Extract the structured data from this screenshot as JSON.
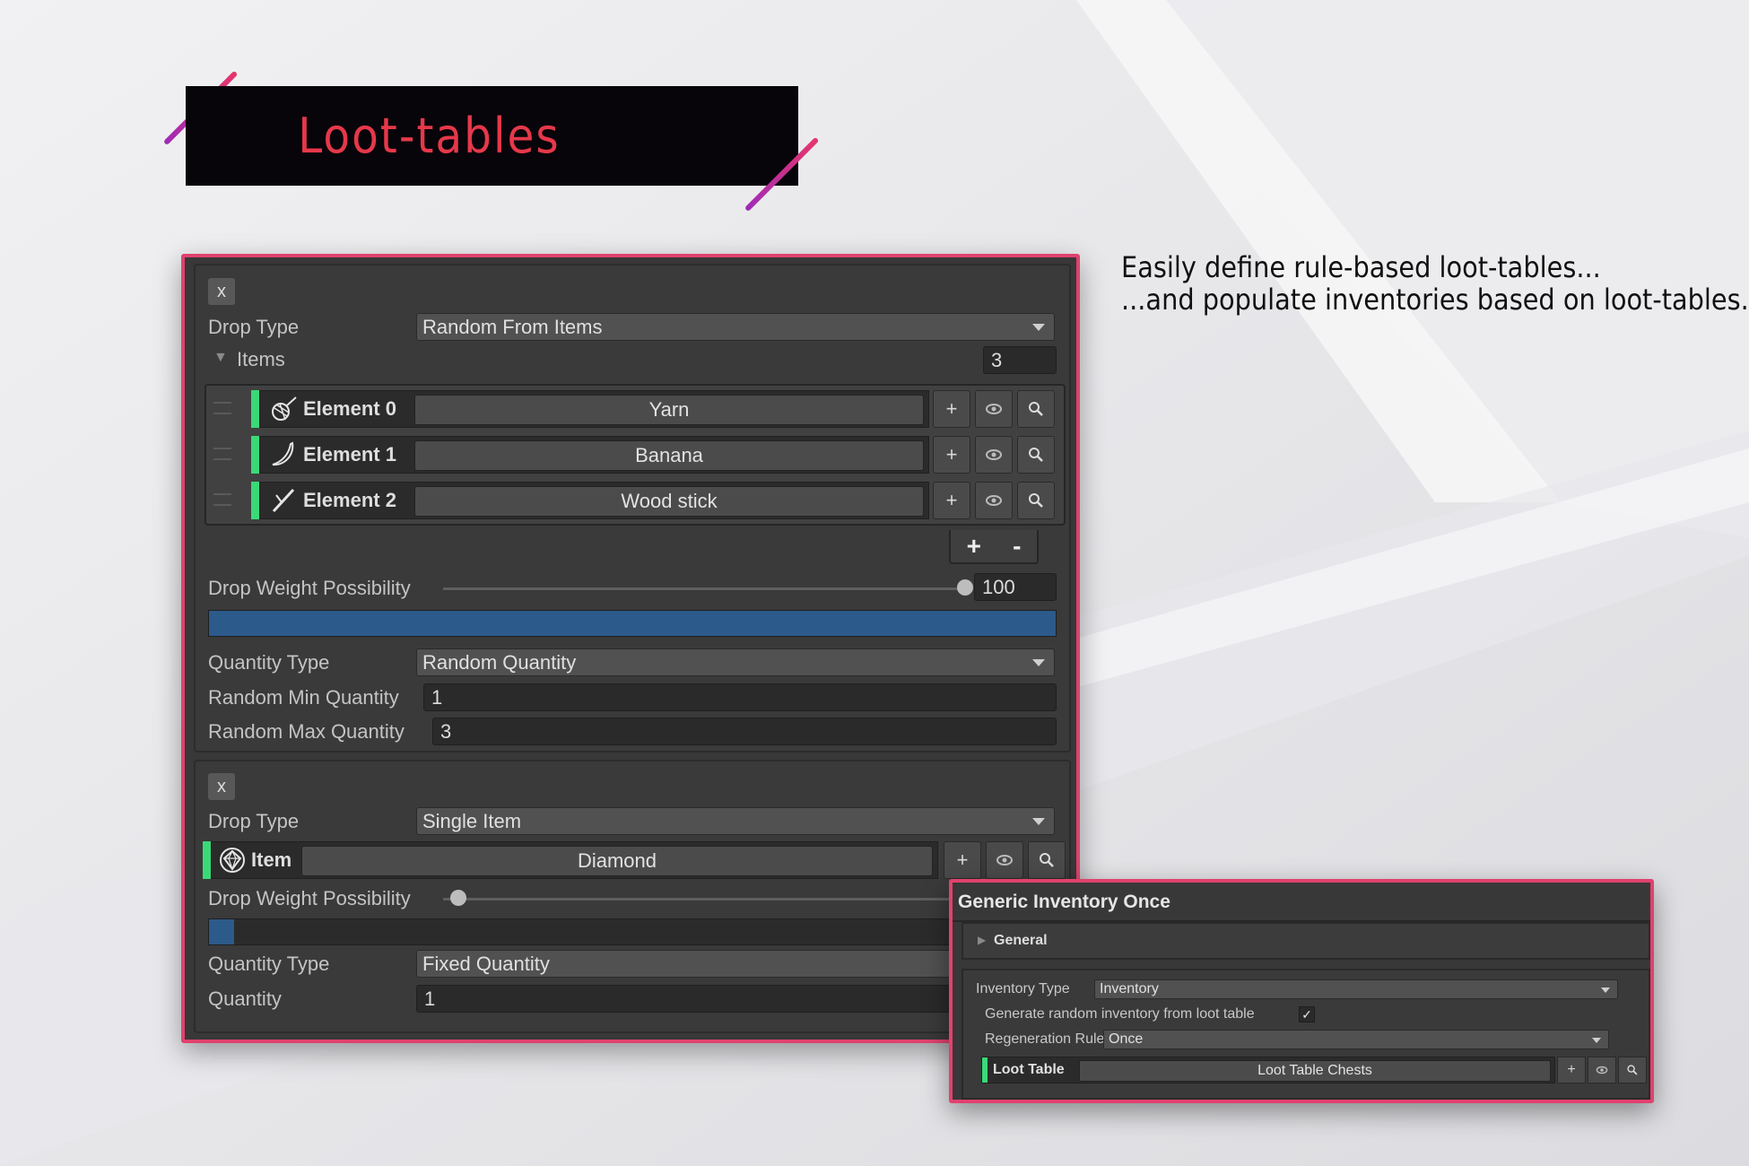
{
  "banner": {
    "title": "Loot-tables"
  },
  "description": {
    "line1": "Easily define rule-based loot-tables...",
    "line2": "...and populate inventories based on loot-tables."
  },
  "entry1": {
    "remove_label": "x",
    "drop_type_label": "Drop Type",
    "drop_type_value": "Random From Items",
    "items_label": "Items",
    "items_count": "3",
    "elements": [
      {
        "label": "Element 0",
        "value": "Yarn",
        "icon": "yarn-icon"
      },
      {
        "label": "Element 1",
        "value": "Banana",
        "icon": "banana-icon"
      },
      {
        "label": "Element 2",
        "value": "Wood stick",
        "icon": "wood-stick-icon"
      }
    ],
    "add_label": "+",
    "remove_item_label": "-",
    "drop_weight_label": "Drop Weight Possibility",
    "drop_weight_value": "100",
    "drop_weight_fraction": 1.0,
    "quantity_type_label": "Quantity Type",
    "quantity_type_value": "Random Quantity",
    "min_label": "Random Min Quantity",
    "min_value": "1",
    "max_label": "Random Max Quantity",
    "max_value": "3"
  },
  "entry2": {
    "remove_label": "x",
    "drop_type_label": "Drop Type",
    "drop_type_value": "Single Item",
    "item_label": "Item",
    "item_value": "Diamond",
    "drop_weight_label": "Drop Weight Possibility",
    "drop_weight_fraction": 0.03,
    "quantity_type_label": "Quantity Type",
    "quantity_type_value": "Fixed Quantity",
    "quantity_label": "Quantity",
    "quantity_value": "1"
  },
  "inventory": {
    "title": "Generic Inventory Once",
    "general_label": "General",
    "inventory_type_label": "Inventory Type",
    "inventory_type_value": "Inventory",
    "generate_label": "Generate random inventory from loot table",
    "generate_checked": "✓",
    "regen_label": "Regeneration Rule",
    "regen_value": "Once",
    "loot_table_label": "Loot Table",
    "loot_table_value": "Loot Table Chests"
  },
  "colors": {
    "accent_border": "#e0426e",
    "banner_text": "#e6384a",
    "row_accent": "#3ad978",
    "weight_fill": "#2c5a8a"
  }
}
